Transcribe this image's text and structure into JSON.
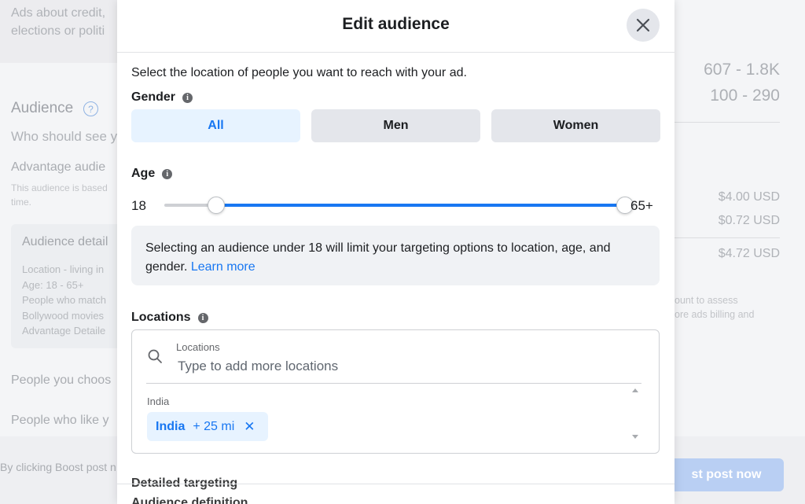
{
  "background": {
    "top_text": "Ads about credit,\nelections or politi",
    "audience_title": "Audience",
    "who_should_see": "Who should see y",
    "advantage_title": "Advantage audie",
    "advantage_desc": "This audience is based\ntime.",
    "audience_details_title": "Audience detail",
    "audience_details_lines": "Location - living in\nAge: 18 - 65+\nPeople who match\nBollywood movies\nAdvantage Detaile",
    "people_you_choose": "People you choos",
    "people_who_like": "People who like y",
    "footer_text": "By clicking Boost post n",
    "reach_range_1": "607 - 1.8K",
    "reach_range_2": "100 - 290",
    "price_1": "$4.00 USD",
    "price_2": "$0.72 USD",
    "price_3": "$4.72 USD",
    "note": "ount to assess\nore ads billing and",
    "boost_button": "st post now"
  },
  "modal": {
    "title": "Edit audience",
    "intro": "Select the location of people you want to reach with your ad.",
    "gender": {
      "label": "Gender",
      "options": [
        "All",
        "Men",
        "Women"
      ],
      "selected": "All"
    },
    "age": {
      "label": "Age",
      "min_label": "18",
      "max_label": "65+",
      "range_min": 13,
      "range_max": 65,
      "selected_min": 18,
      "selected_max": 65
    },
    "notice": {
      "text": "Selecting an audience under 18 will limit your targeting options to location, age, and gender. ",
      "link": "Learn more"
    },
    "locations": {
      "label": "Locations",
      "search_label": "Locations",
      "search_placeholder": "Type to add more locations",
      "country_label": "India",
      "chip": {
        "name": "India",
        "radius": "+ 25 mi",
        "remove": "✕"
      }
    },
    "detailed_targeting_label": "Detailed targeting",
    "audience_definition_label": "Audience definition"
  },
  "colors": {
    "accent": "#1877f2",
    "accent_light": "#e7f3ff",
    "button_gray": "#e4e6eb",
    "notice_bg": "#f0f2f5"
  }
}
